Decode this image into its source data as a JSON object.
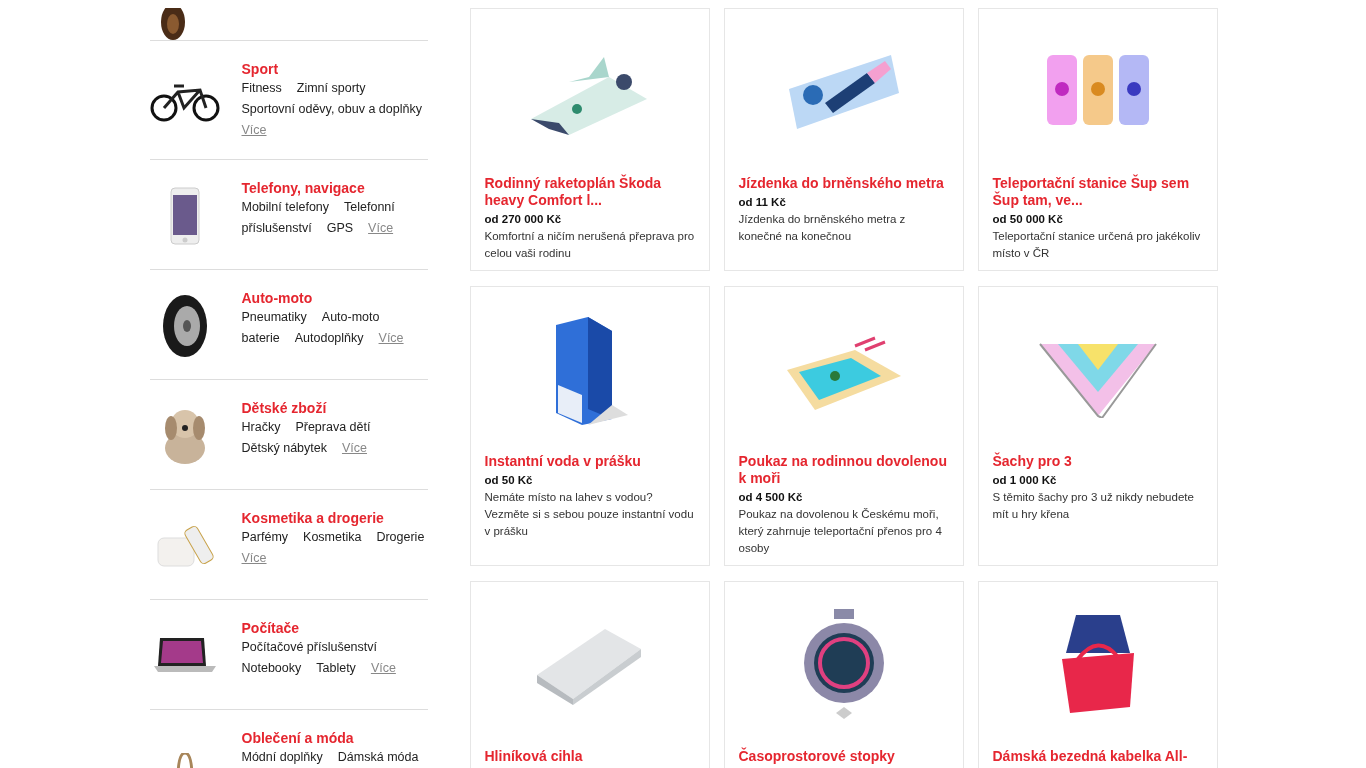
{
  "categories": [
    {
      "title": "Sport",
      "links": [
        "Fitness",
        "Zimní sporty",
        "Sportovní oděvy, obuv a doplňky"
      ],
      "more": "Více"
    },
    {
      "title": "Telefony, navigace",
      "links": [
        "Mobilní telefony",
        "Telefonní",
        "příslušenství",
        "GPS"
      ],
      "more": "Více"
    },
    {
      "title": "Auto-moto",
      "links": [
        "Pneumatiky",
        "Auto-moto",
        "baterie",
        "Autodoplňky"
      ],
      "more": "Více"
    },
    {
      "title": "Dětské zboží",
      "links": [
        "Hračky",
        "Přeprava dětí",
        "Dětský nábytek"
      ],
      "more": "Více"
    },
    {
      "title": "Kosmetika a drogerie",
      "links": [
        "Parfémy",
        "Kosmetika",
        "Drogerie"
      ],
      "more": "Více"
    },
    {
      "title": "Počítače",
      "links": [
        "Počítačové příslušenství",
        "Notebooky",
        "Tablety"
      ],
      "more": "Více"
    },
    {
      "title": "Oblečení a móda",
      "links": [
        "Módní doplňky",
        "Dámská móda"
      ]
    }
  ],
  "products": [
    {
      "name": "Rodinný raketoplán Škoda heavy Comfort l...",
      "price": "od 270 000 Kč",
      "description": "Komfortní a ničím nerušená přeprava pro celou vaši rodinu"
    },
    {
      "name": "Jízdenka do brněnského metra",
      "price": "od 11 Kč",
      "description": "Jízdenka do brněnského metra z konečné na konečnou"
    },
    {
      "name": "Teleportační stanice Šup sem Šup tam, ve...",
      "price": "od 50 000 Kč",
      "description": "Teleportační stanice určená pro jakékoliv místo v ČR"
    },
    {
      "name": "Instantní voda v prášku",
      "price": "od 50 Kč",
      "description": "Nemáte místo na lahev s vodou? Vezměte si s sebou pouze instantní vodu v prášku"
    },
    {
      "name": "Poukaz na rodinnou dovolenou k moři",
      "price": "od 4 500 Kč",
      "description": "Poukaz na dovolenou k Českému moři, který zahrnuje teleportační přenos pro 4 osoby"
    },
    {
      "name": "Šachy pro 3",
      "price": "od 1 000 Kč",
      "description": "S těmito šachy pro 3 už nikdy nebudete mít u hry křena"
    },
    {
      "name": "Hliníková cihla"
    },
    {
      "name": "Časoprostorové stopky"
    },
    {
      "name": "Dámská bezedná kabelka All-"
    }
  ]
}
